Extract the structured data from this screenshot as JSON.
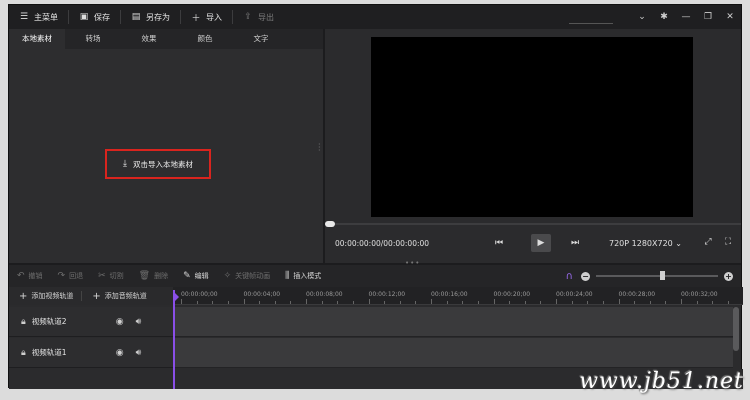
{
  "titlebar": {
    "menu": "主菜单",
    "save": "保存",
    "save_as": "另存为",
    "import": "导入",
    "export": "导出"
  },
  "left_panel": {
    "tabs": [
      "本地素材",
      "转场",
      "效果",
      "颜色",
      "文字"
    ],
    "active_tab": "本地素材",
    "import_label": "双击导入本地素材"
  },
  "preview": {
    "timecode": "00:00:00:00/00:00:00:00",
    "resolution": "720P 1280X720",
    "progress": 0
  },
  "edit_toolbar": {
    "undo": "撤销",
    "redo": "回退",
    "cut": "切割",
    "delete": "删除",
    "edit": "编辑",
    "keyframe": "关键帧动画",
    "insert_mode": "插入模式",
    "zoom_level": 0.55
  },
  "timeline": {
    "add_video": "添加视频轨道",
    "add_audio": "添加音频轨道",
    "ruler": [
      "00:00:00;00",
      "00:00:04;00",
      "00:00:08;00",
      "00:00:12;00",
      "00:00:16;00",
      "00:00:20;00",
      "00:00:24;00",
      "00:00:28;00",
      "00:00:32;00"
    ],
    "tracks": [
      "视频轨道2",
      "视频轨道1"
    ]
  },
  "watermark": "www.jb51.net",
  "colors": {
    "accent": "#8a4fe8",
    "highlight_border": "#d9241e",
    "background": "#2b2b2d"
  }
}
